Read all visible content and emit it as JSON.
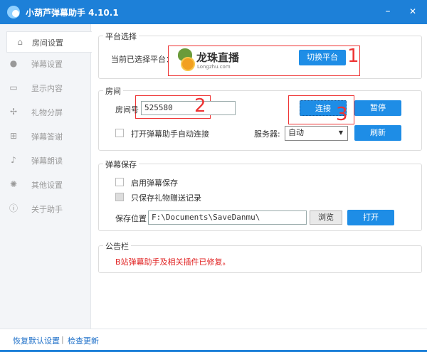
{
  "app": {
    "title": "小葫芦弹幕助手 4.10.1",
    "minimize": "–",
    "close": "✕"
  },
  "sidebar": {
    "items": [
      {
        "label": "房间设置",
        "icon": "home-icon",
        "glyph": "⌂"
      },
      {
        "label": "弹幕设置",
        "icon": "chat-bubble-icon",
        "glyph": "●"
      },
      {
        "label": "显示内容",
        "icon": "monitor-icon",
        "glyph": "▭"
      },
      {
        "label": "礼物分屏",
        "icon": "split-icon",
        "glyph": "✢"
      },
      {
        "label": "弹幕答谢",
        "icon": "gift-icon",
        "glyph": "⊞"
      },
      {
        "label": "弹幕朗读",
        "icon": "microphone-icon",
        "glyph": "♪"
      },
      {
        "label": "其他设置",
        "icon": "gear-icon",
        "glyph": "✺"
      },
      {
        "label": "关于助手",
        "icon": "info-icon",
        "glyph": "ⓘ"
      }
    ]
  },
  "platform": {
    "group_label": "平台选择",
    "current_label": "当前已选择平台：",
    "platform_name": "龙珠直播",
    "platform_domain": "Longzhu.com",
    "switch_button": "切换平台",
    "annotation": "1"
  },
  "room": {
    "group_label": "房间",
    "room_label": "房间号",
    "room_value": "525580",
    "annotation_room": "2",
    "connect_button": "连接",
    "annotation_connect": "3",
    "pause_button": "暂停",
    "auto_connect_label": "打开弹幕助手自动连接",
    "server_label": "服务器:",
    "server_value": "自动",
    "refresh_button": "刷新"
  },
  "save": {
    "group_label": "弹幕保存",
    "enable_label": "启用弹幕保存",
    "gift_only_label": "只保存礼物赠送记录",
    "path_label": "保存位置",
    "path_value": "F:\\Documents\\SaveDanmu\\",
    "browse_button": "浏览",
    "open_button": "打开"
  },
  "notice": {
    "group_label": "公告栏",
    "message": "B站弹幕助手及相关插件已修复。"
  },
  "footer": {
    "restore_link": "恢复默认设置",
    "separator": "|",
    "update_link": "检查更新"
  }
}
